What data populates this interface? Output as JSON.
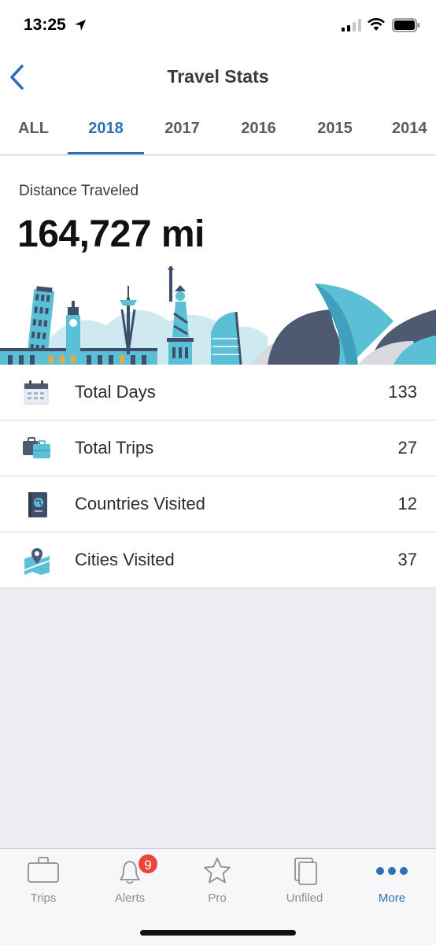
{
  "status": {
    "time": "13:25"
  },
  "nav": {
    "title": "Travel Stats"
  },
  "tabs": [
    {
      "label": "ALL"
    },
    {
      "label": "2018"
    },
    {
      "label": "2017"
    },
    {
      "label": "2016"
    },
    {
      "label": "2015"
    },
    {
      "label": "2014"
    }
  ],
  "distance": {
    "label": "Distance Traveled",
    "value": "164,727 mi"
  },
  "stats": [
    {
      "label": "Total Days",
      "value": "133",
      "icon": "calendar-icon"
    },
    {
      "label": "Total Trips",
      "value": "27",
      "icon": "suitcase-icon"
    },
    {
      "label": "Countries Visited",
      "value": "12",
      "icon": "passport-icon"
    },
    {
      "label": "Cities Visited",
      "value": "37",
      "icon": "map-pin-icon"
    }
  ],
  "tabbar": {
    "items": [
      {
        "label": "Trips",
        "icon": "briefcase-icon"
      },
      {
        "label": "Alerts",
        "icon": "bell-icon",
        "badge": "9"
      },
      {
        "label": "Pro",
        "icon": "star-icon"
      },
      {
        "label": "Unfiled",
        "icon": "documents-icon"
      },
      {
        "label": "More",
        "icon": "more-dots-icon"
      }
    ]
  },
  "colors": {
    "accent": "#2f6fb5",
    "badge": "#e8463c",
    "teal": "#5bbfd6",
    "navy": "#3f4f6b"
  }
}
